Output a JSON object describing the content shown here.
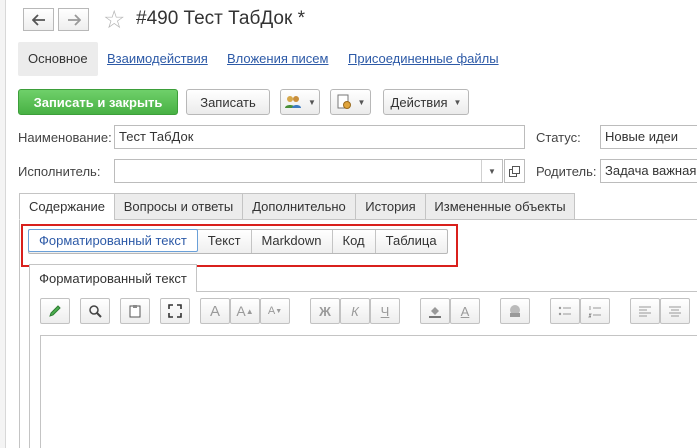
{
  "window": {
    "title": "#490 Тест ТабДок *"
  },
  "nav": {
    "back_icon": "arrow-left-icon",
    "forward_icon": "arrow-right-icon",
    "star_icon": "star-icon"
  },
  "top_tabs": [
    {
      "label": "Основное",
      "active": true
    },
    {
      "label": "Взаимодействия",
      "active": false
    },
    {
      "label": "Вложения писем",
      "active": false
    },
    {
      "label": "Присоединенные файлы",
      "active": false
    }
  ],
  "toolbar": {
    "save_close_label": "Записать и закрыть",
    "save_label": "Записать",
    "actions_label": "Действия",
    "users_icon": "users-icon",
    "doc_icon": "document-gear-icon"
  },
  "form": {
    "name_label": "Наименование:",
    "name_value": "Тест ТабДок",
    "status_label": "Статус:",
    "status_value": "Новые идеи",
    "executor_label": "Исполнитель:",
    "executor_value": "",
    "parent_label": "Родитель:",
    "parent_value": "Задача важная"
  },
  "tabs": [
    {
      "label": "Содержание",
      "active": true
    },
    {
      "label": "Вопросы и ответы",
      "active": false
    },
    {
      "label": "Дополнительно",
      "active": false
    },
    {
      "label": "История",
      "active": false
    },
    {
      "label": "Измененные объекты",
      "active": false
    }
  ],
  "format_modes": [
    {
      "label": "Форматированный текст",
      "active": true
    },
    {
      "label": "Текст",
      "active": false
    },
    {
      "label": "Markdown",
      "active": false
    },
    {
      "label": "Код",
      "active": false
    },
    {
      "label": "Таблица",
      "active": false
    }
  ],
  "editor": {
    "tab_label": "Форматированный текст",
    "buttons": {
      "bold": "Ж",
      "italic": "К",
      "underline": "Ч",
      "font_a": "A"
    }
  },
  "colors": {
    "accent_link": "#2d5aa7",
    "green_button": "#48b144",
    "highlight_box": "#d9201c"
  }
}
